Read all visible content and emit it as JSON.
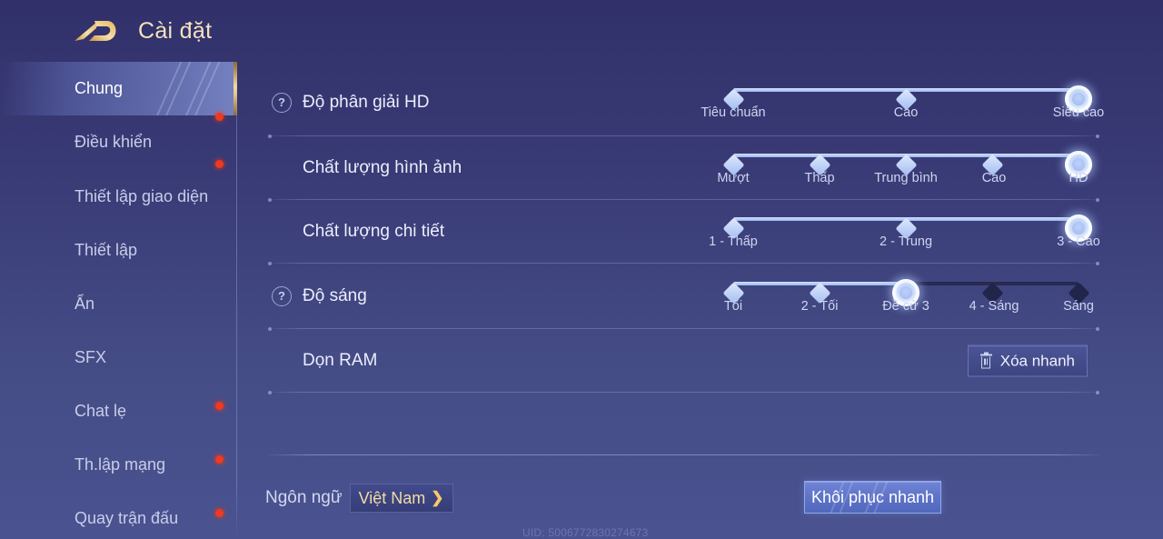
{
  "header": {
    "title": "Cài đặt",
    "logo_icon": "gold-d-logo"
  },
  "sidebar": {
    "items": [
      {
        "label": "Chung",
        "active": true,
        "dot": false
      },
      {
        "label": "Điều khiển",
        "active": false,
        "dot": true
      },
      {
        "label": "Thiết lập giao diện",
        "active": false,
        "dot": true
      },
      {
        "label": "Thiết lập",
        "active": false,
        "dot": false
      },
      {
        "label": "Ẩn",
        "active": false,
        "dot": false
      },
      {
        "label": "SFX",
        "active": false,
        "dot": false
      },
      {
        "label": "Chat lẹ",
        "active": false,
        "dot": true
      },
      {
        "label": "Th.lập mạng",
        "active": false,
        "dot": true
      },
      {
        "label": "Quay trận đấu",
        "active": false,
        "dot": true
      }
    ]
  },
  "settings": {
    "rows": [
      {
        "label": "Độ phân giải HD",
        "help_icon": "question-mark-icon",
        "has_help": true,
        "type": "slider",
        "options": [
          "Tiêu chuẩn",
          "Cao",
          "Siêu cao"
        ],
        "selected_index": 2
      },
      {
        "label": "Chất lượng hình ảnh",
        "has_help": false,
        "type": "slider",
        "options": [
          "Mượt",
          "Thấp",
          "Trung bình",
          "Cao",
          "HD"
        ],
        "selected_index": 4
      },
      {
        "label": "Chất lượng chi tiết",
        "has_help": false,
        "type": "slider",
        "options": [
          "1 - Thấp",
          "2 - Trung",
          "3 - Cao"
        ],
        "selected_index": 2
      },
      {
        "label": "Độ sáng",
        "help_icon": "question-mark-icon",
        "has_help": true,
        "type": "slider",
        "options": [
          "Tối",
          "2 - Tối",
          "Đề cử 3",
          "4 - Sáng",
          "Sáng"
        ],
        "selected_index": 2
      },
      {
        "label": "Dọn RAM",
        "has_help": false,
        "type": "button",
        "button_label": "Xóa nhanh",
        "button_icon": "trash-icon"
      }
    ]
  },
  "footer": {
    "language_label": "Ngôn ngữ",
    "language_value": "Việt Nam",
    "language_chevron": "❯",
    "uid": "UID: 5006772830274673",
    "restore_label": "Khôi phục nhanh"
  },
  "colors": {
    "background_top": "#31306a",
    "background_bottom": "#4a5390",
    "accent_gold": "#f3d79a",
    "slider_fill": "#cfe0fb",
    "slider_empty": "#272a52",
    "notification_dot": "#f3381b",
    "restore_button": "#5f74c9"
  }
}
